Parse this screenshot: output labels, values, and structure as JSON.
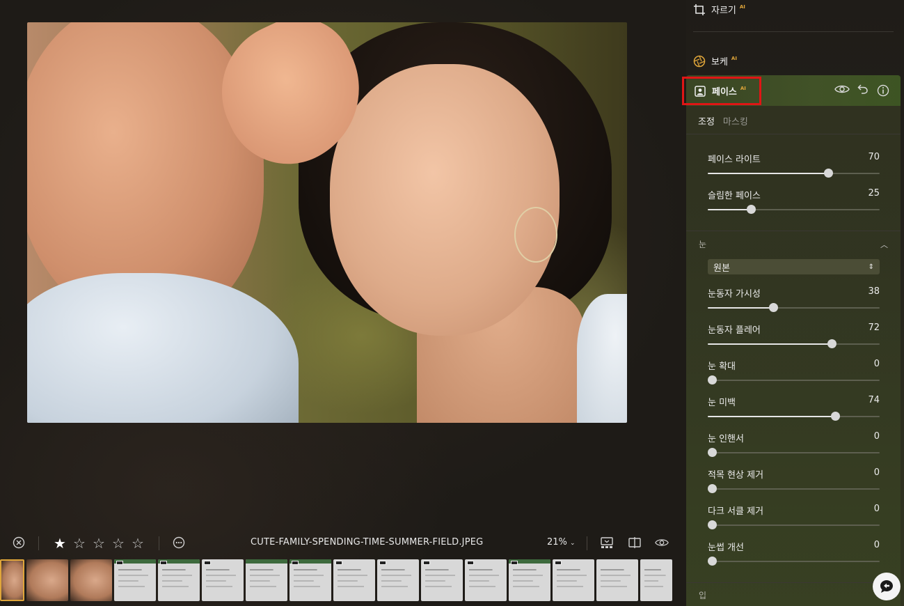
{
  "toolbar": {
    "filename": "CUTE-FAMILY-SPENDING-TIME-SUMMER-FIELD.JPEG",
    "zoom": "21%",
    "rating": 1,
    "max_rating": 5
  },
  "panel": {
    "crop": {
      "label": "자르기",
      "ai": "AI"
    },
    "bokeh": {
      "label": "보케",
      "ai": "AI"
    },
    "face": {
      "label": "페이스",
      "ai": "AI"
    },
    "tabs": {
      "adjust": "조정",
      "masking": "마스킹"
    },
    "face_sliders": [
      {
        "label": "페이스 라이트",
        "value": "70",
        "percent": 70
      },
      {
        "label": "슬림한 페이스",
        "value": "25",
        "percent": 25
      }
    ],
    "eye_section": {
      "title": "눈",
      "select_value": "원본",
      "sliders": [
        {
          "label": "눈동자 가시성",
          "value": "38",
          "percent": 38
        },
        {
          "label": "눈동자 플레어",
          "value": "72",
          "percent": 72
        },
        {
          "label": "눈 확대",
          "value": "0",
          "percent": 0
        },
        {
          "label": "눈 미백",
          "value": "74",
          "percent": 74
        },
        {
          "label": "눈 인핸서",
          "value": "0",
          "percent": 0
        },
        {
          "label": "적목 현상 제거",
          "value": "0",
          "percent": 0
        },
        {
          "label": "다크 서클 제거",
          "value": "0",
          "percent": 0
        },
        {
          "label": "눈썹 개선",
          "value": "0",
          "percent": 0
        }
      ]
    },
    "mouth_section": {
      "title": "입"
    }
  },
  "colors": {
    "accent": "#e0a63a",
    "highlight_box": "#e01515",
    "face_header": "#415227"
  }
}
